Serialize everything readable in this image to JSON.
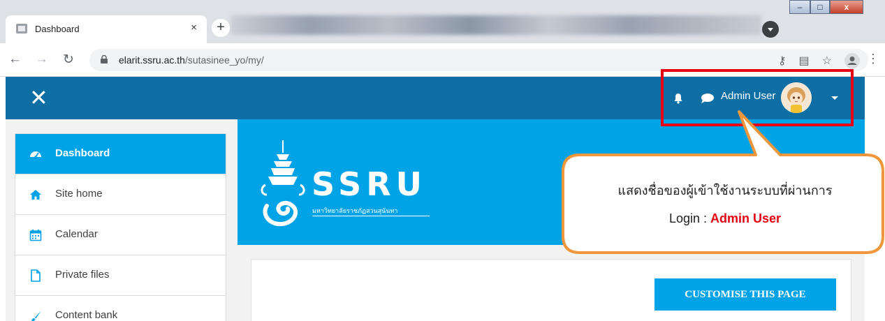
{
  "browser": {
    "tab_title": "Dashboard",
    "tab_close": "×",
    "new_tab": "+",
    "url_host": "elarit.ssru.ac.th",
    "url_path": "/sutasinee_yo/my/"
  },
  "navbar": {
    "close_glyph": "✕",
    "user_name": "Admin User"
  },
  "drawer": {
    "items": [
      {
        "label": "Dashboard",
        "icon": "dashboard-icon"
      },
      {
        "label": "Site home",
        "icon": "home-icon"
      },
      {
        "label": "Calendar",
        "icon": "calendar-icon"
      },
      {
        "label": "Private files",
        "icon": "file-icon"
      },
      {
        "label": "Content bank",
        "icon": "brush-icon"
      }
    ]
  },
  "banner": {
    "logo_text": "SSRU",
    "logo_subtitle": "มหาวิทยาลัยราชภัฏสวนสุนันทา"
  },
  "main": {
    "customise_label": "CUSTOMISE THIS PAGE"
  },
  "callout": {
    "line1": "แสดงชื่อของผู้เข้าใช้งานระบบที่ผ่านการ",
    "line2_prefix": "Login : ",
    "line2_highlight": "Admin User"
  },
  "colors": {
    "navbar": "#0f6fa4",
    "accent": "#00a2e8",
    "highlight": "#e60012",
    "callout_border": "#f0973e"
  }
}
